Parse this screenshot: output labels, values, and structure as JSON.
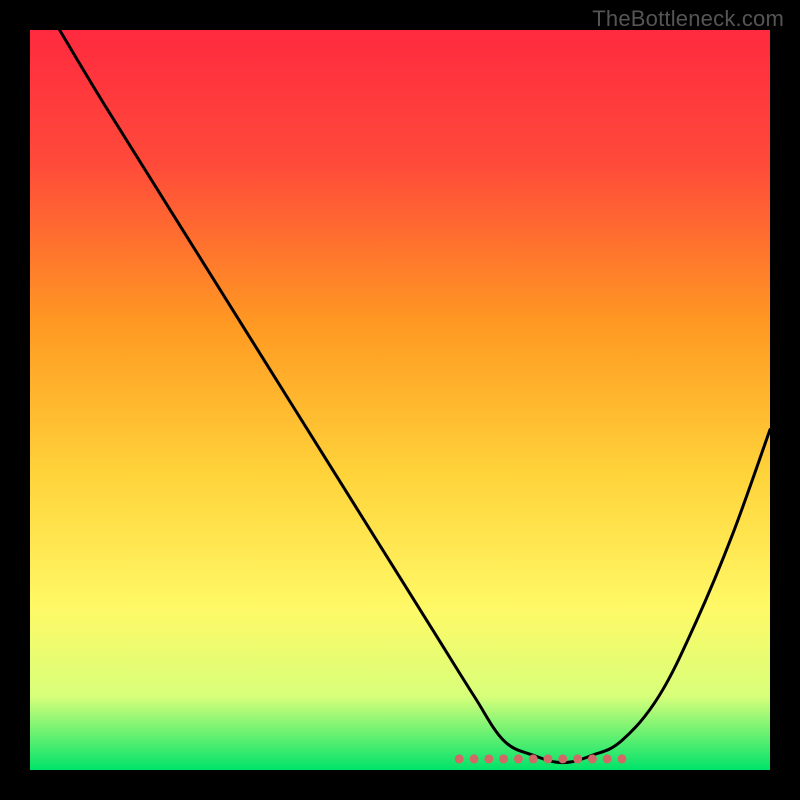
{
  "watermark": "TheBottleneck.com",
  "colors": {
    "red_top": "#ff2a3f",
    "orange_mid": "#ffa500",
    "yellow_low": "#fff966",
    "green_bottom": "#00e36a",
    "curve": "#000000",
    "dot": "#d16a66"
  },
  "chart_data": {
    "type": "line",
    "title": "",
    "xlabel": "",
    "ylabel": "",
    "xlim": [
      0,
      100
    ],
    "ylim": [
      0,
      100
    ],
    "grid": false,
    "legend": false,
    "series": [
      {
        "name": "bottleneck-curve",
        "x": [
          4,
          10,
          20,
          30,
          40,
          50,
          55,
          60,
          64,
          68,
          72,
          76,
          80,
          85,
          90,
          95,
          100
        ],
        "y": [
          100,
          90,
          74,
          58,
          42,
          26,
          18,
          10,
          4,
          2,
          1,
          2,
          4,
          10,
          20,
          32,
          46
        ]
      }
    ],
    "dotted_band": {
      "name": "optimal-range",
      "x_points": [
        58,
        60,
        62,
        64,
        66,
        68,
        70,
        72,
        74,
        76,
        78,
        80
      ],
      "y": 1.5
    }
  }
}
